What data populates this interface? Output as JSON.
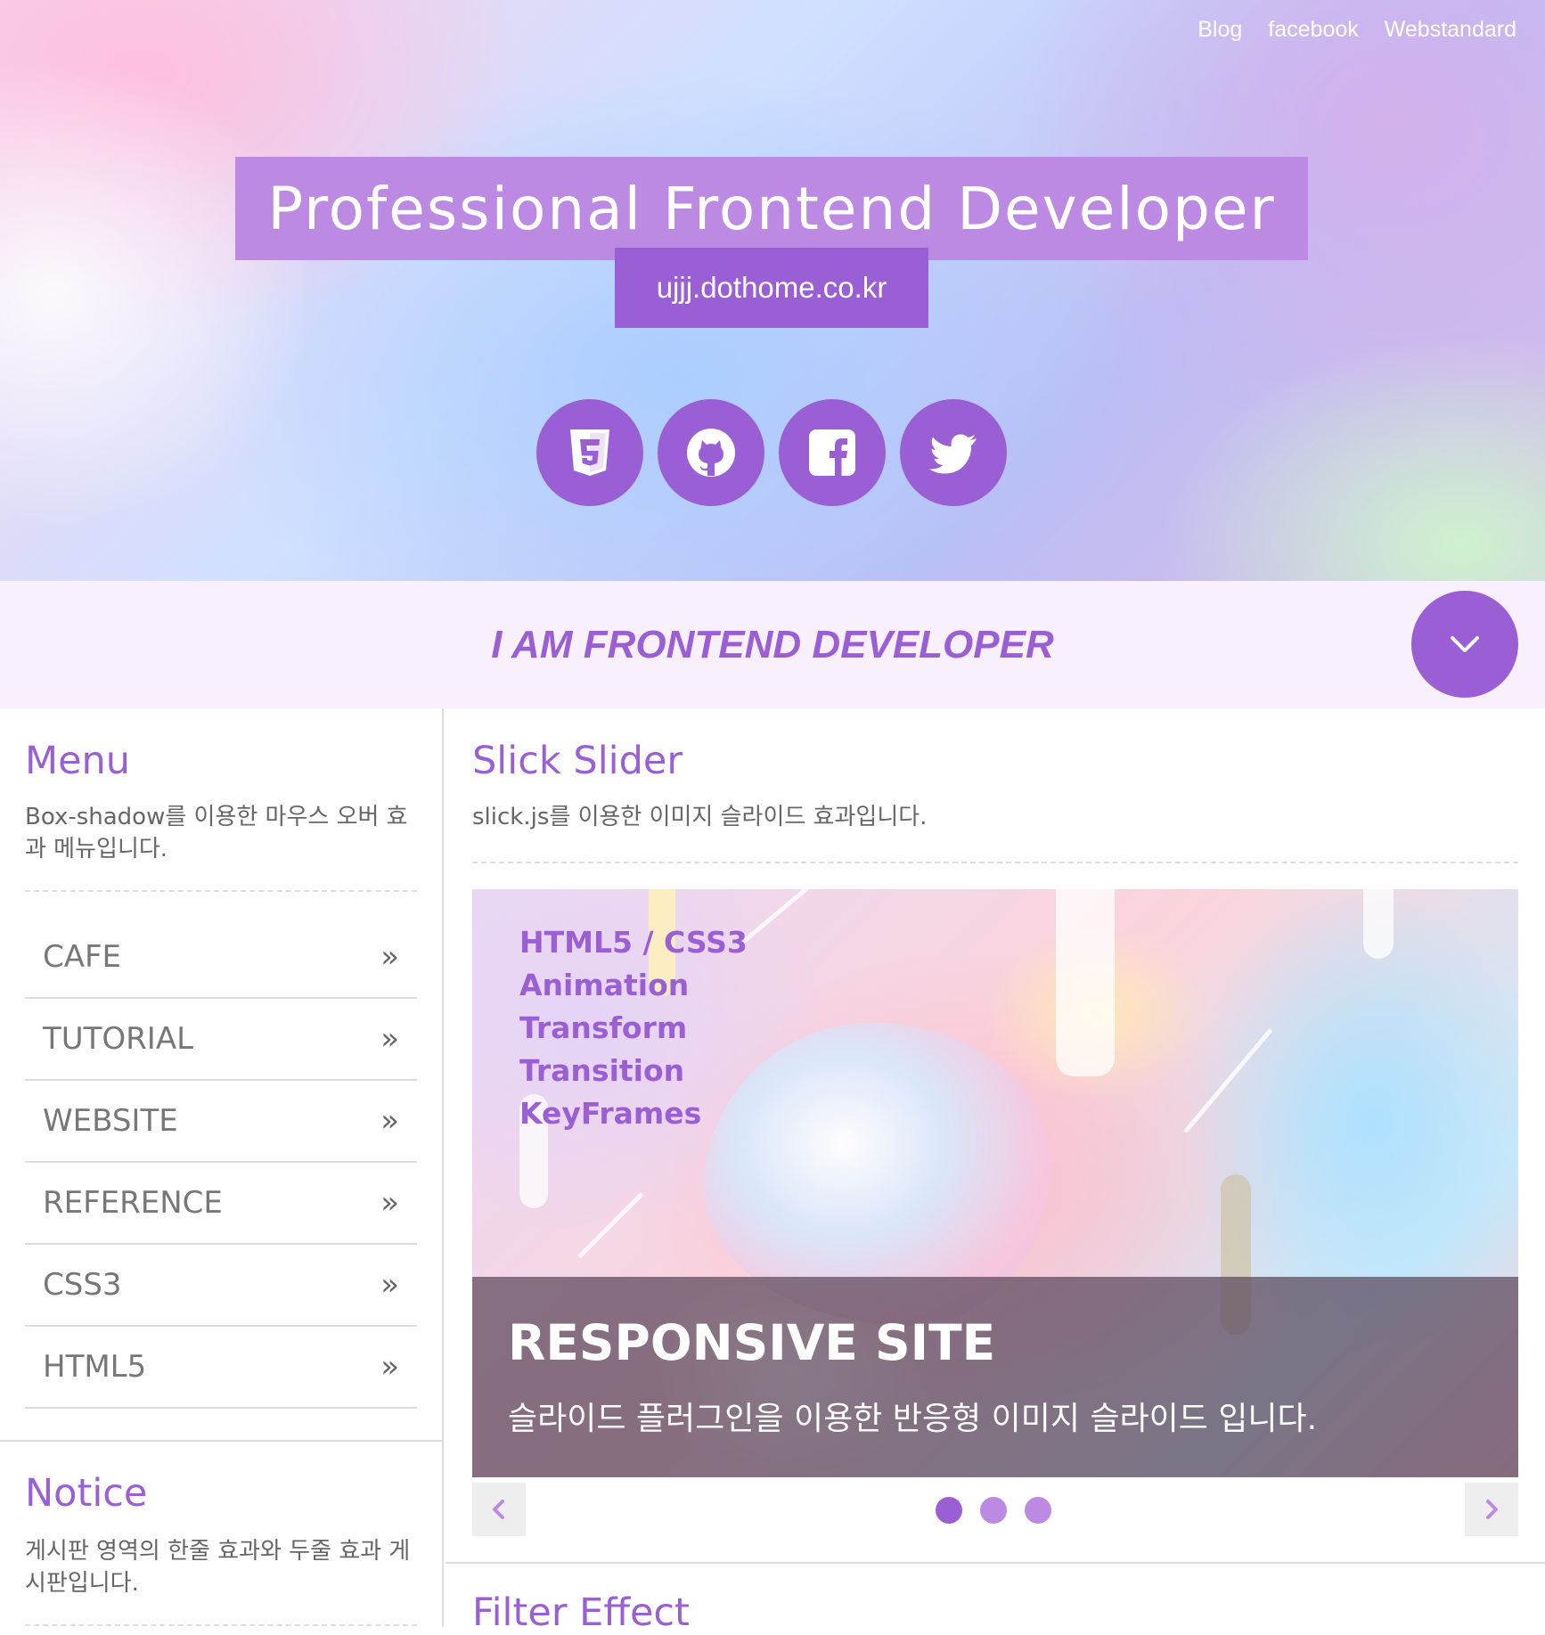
{
  "header": {
    "nav": [
      "Blog",
      "facebook",
      "Webstandard"
    ],
    "title": "Professional Frontend Developer",
    "url": "ujjj.dothome.co.kr",
    "social_icons": [
      "html5-icon",
      "github-icon",
      "facebook-icon",
      "twitter-icon"
    ]
  },
  "banner": {
    "text": "I AM FRONTEND DEVELOPER",
    "button_icon": "chevron-down-icon"
  },
  "menu": {
    "title": "Menu",
    "desc": "Box-shadow를 이용한 마우스 오버 효과 메뉴입니다.",
    "items": [
      {
        "label": "CAFE",
        "arrow": "»"
      },
      {
        "label": "TUTORIAL",
        "arrow": "»"
      },
      {
        "label": "WEBSITE",
        "arrow": "»"
      },
      {
        "label": "REFERENCE",
        "arrow": "»"
      },
      {
        "label": "CSS3",
        "arrow": "»"
      },
      {
        "label": "HTML5",
        "arrow": "»"
      }
    ]
  },
  "notice": {
    "title": "Notice",
    "desc": "게시판 영역의 한줄 효과와 두줄 효과 게시판입니다."
  },
  "slider": {
    "title": "Slick Slider",
    "desc": "slick.js를 이용한 이미지 슬라이드 효과입니다.",
    "slide_list": [
      "HTML5 / CSS3",
      "Animation",
      "Transform",
      "Transition",
      "KeyFrames"
    ],
    "caption_title": "RESPONSIVE SITE",
    "caption_text": "슬라이드 플러그인을 이용한 반응형 이미지 슬라이드 입니다.",
    "prev_icon": "chevron-left-icon",
    "next_icon": "chevron-right-icon",
    "dots": 3,
    "active_dot": 0
  },
  "filter": {
    "title": "Filter Effect"
  },
  "colors": {
    "accent": "#9a5fd4",
    "accent_light": "#bc8ae3",
    "banner_bg": "#f8f0fd"
  }
}
